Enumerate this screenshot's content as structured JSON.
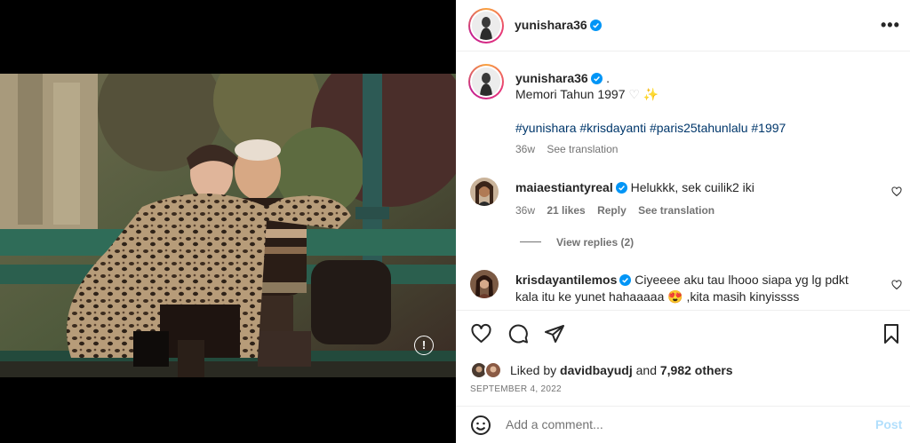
{
  "post": {
    "author": "yunishara36",
    "author_dot": ".",
    "caption_line1": "Memori Tahun 1997",
    "caption_emoji": "♡ ✨",
    "hashtags": "#yunishara #krisdayanti #paris25tahunlalu #1997",
    "age": "36w",
    "see_translation": "See translation"
  },
  "comments": [
    {
      "user": "maiaestiantyreal",
      "text": "Helukkk, sek cuilik2 iki",
      "age": "36w",
      "likes": "21 likes",
      "reply": "Reply",
      "see_translation": "See translation",
      "view_replies": "View replies (2)"
    },
    {
      "user": "krisdayantilemos",
      "text_line1": "Ciyeeee aku tau lhooo siapa yg lg pdkt",
      "text_line2": "kala itu ke yunet hahaaaaa 😍 ,kita masih kinyissss"
    }
  ],
  "likes": {
    "prefix": "Liked by",
    "user": "davidbayudj",
    "and": "and",
    "others": "7,982 others"
  },
  "date": "SEPTEMBER 4, 2022",
  "comment_box": {
    "placeholder": "Add a comment...",
    "post_label": "Post"
  },
  "icons": {
    "more": "more-options-icon",
    "like": "heart-icon",
    "comment": "comment-icon",
    "share": "paper-plane-icon",
    "save": "bookmark-icon",
    "emoji": "emoji-icon",
    "verified": "verified-badge-icon",
    "info": "info-icon"
  },
  "colors": {
    "verified_blue": "#0095f6",
    "hashtag": "#00376b",
    "muted": "#737373",
    "post_disabled": "#b2dffc"
  }
}
